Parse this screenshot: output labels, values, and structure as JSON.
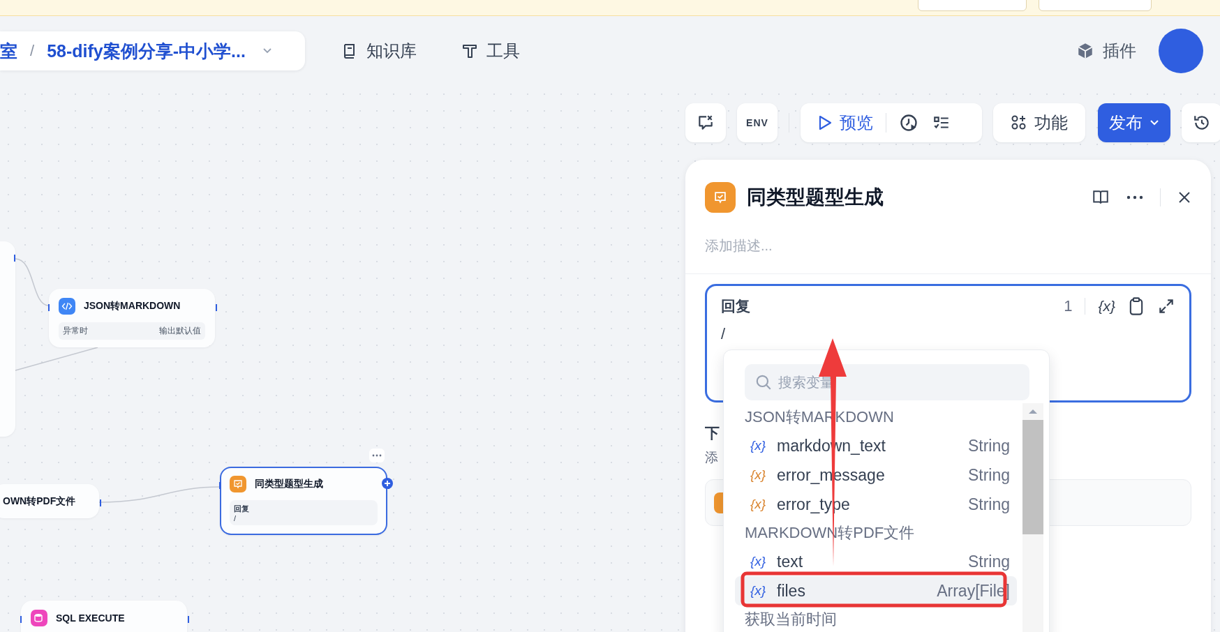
{
  "breadcrumb": {
    "parent": "室",
    "separator": "/",
    "current": "58-dify案例分享-中小学..."
  },
  "nav": [
    {
      "label": "知识库",
      "kind": "book"
    },
    {
      "label": "工具",
      "kind": "tool"
    }
  ],
  "plugins": {
    "label": "插件"
  },
  "toolbar": {
    "env": "ENV",
    "preview": "预览",
    "features": "功能",
    "publish": "发布"
  },
  "nodes": [
    {
      "kind": "partial",
      "selected": false
    },
    {
      "kind": "code",
      "title": "JSON转MARKDOWN",
      "error_label": "异常时",
      "error_value": "输出默认值",
      "selected": false
    },
    {
      "kind": "plain",
      "title": "OWN转PDF文件",
      "selected": false
    },
    {
      "kind": "answer",
      "title": "同类型题型生成",
      "field_label": "回复",
      "field_value": "/",
      "selected": true
    },
    {
      "kind": "sql",
      "title": "SQL EXECUTE",
      "selected": false
    }
  ],
  "panel": {
    "title": "同类型题型生成",
    "description_placeholder": "添加描述...",
    "reply": {
      "label": "回复",
      "count": "1",
      "var_icon": "{x}",
      "value": "/"
    },
    "next_step": {
      "label": "下",
      "hint": "添"
    }
  },
  "dropdown": {
    "search_placeholder": "搜索变量",
    "groups": [
      {
        "title": "JSON转MARKDOWN",
        "vars": [
          {
            "icon": "{x}",
            "name": "markdown_text",
            "type": "String",
            "color": "#2f5ee0",
            "selected": false
          },
          {
            "icon": "{x}",
            "name": "error_message",
            "type": "String",
            "color": "#d9822b",
            "selected": false
          },
          {
            "icon": "{x}",
            "name": "error_type",
            "type": "String",
            "color": "#d9822b",
            "selected": false
          }
        ]
      },
      {
        "title": "MARKDOWN转PDF文件",
        "vars": [
          {
            "icon": "{x}",
            "name": "text",
            "type": "String",
            "color": "#2f5ee0",
            "selected": false
          },
          {
            "icon": "{x}",
            "name": "files",
            "type": "Array[File]",
            "color": "#2f5ee0",
            "selected": true
          }
        ]
      },
      {
        "title": "获取当前时间"
      }
    ]
  }
}
